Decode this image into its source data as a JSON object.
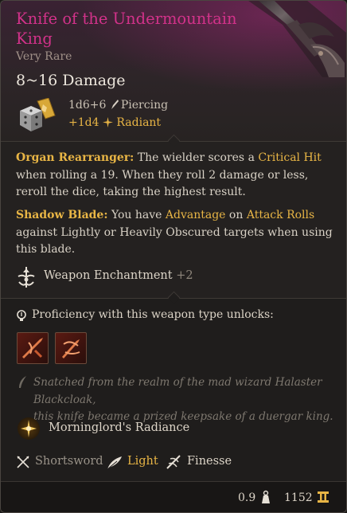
{
  "item": {
    "name": "Knife of the Undermountain King",
    "name_line1": "Knife of the Undermountain",
    "name_line2": "King",
    "rarity": "Very Rare",
    "damage_range": "8~16 Damage",
    "base_damage": "1d6+6",
    "base_damage_type": "Piercing",
    "bonus_damage": "+1d4",
    "bonus_damage_type": "Radiant",
    "colors": {
      "title": "#d2328a",
      "accent": "#e8b545",
      "text": "#d9d2c6"
    }
  },
  "passives": [
    {
      "name": "Organ Rearranger:",
      "line1_pre": "The wielder scores a ",
      "line1_kw": "Critical Hit",
      "line2": "when rolling a 19. When they roll 2 damage or less,",
      "line3": "reroll the dice, taking the highest result."
    },
    {
      "name": "Shadow Blade:",
      "line1_pre": "You have ",
      "line1_kw1": "Advantage",
      "line1_mid": " on ",
      "line1_kw2": "Attack Rolls",
      "line2": "against Lightly or Heavily Obscured targets when using",
      "line3": "this blade."
    }
  ],
  "enchantment": {
    "label": "Weapon Enchantment",
    "value": "+2",
    "icon": "weapon-enchantment-icon"
  },
  "proficiency": {
    "label": "Proficiency with this weapon type unlocks:",
    "actions": [
      {
        "icon": "piercing-strike-icon"
      },
      {
        "icon": "flourish-icon"
      }
    ]
  },
  "flavor": {
    "line1": "Snatched from the realm of the mad wizard Halaster Blackcloak,",
    "line2": "this knife became a prized keepsake of a duergar king."
  },
  "spell": {
    "label": "Morninglord's Radiance",
    "icon": "sun-icon"
  },
  "properties": [
    {
      "label": "Shortsword",
      "icon": "crossed-swords-icon"
    },
    {
      "label": "Light",
      "icon": "feather-icon"
    },
    {
      "label": "Finesse",
      "icon": "finesse-icon"
    }
  ],
  "footer": {
    "weight": "0.9",
    "value": "1152"
  }
}
